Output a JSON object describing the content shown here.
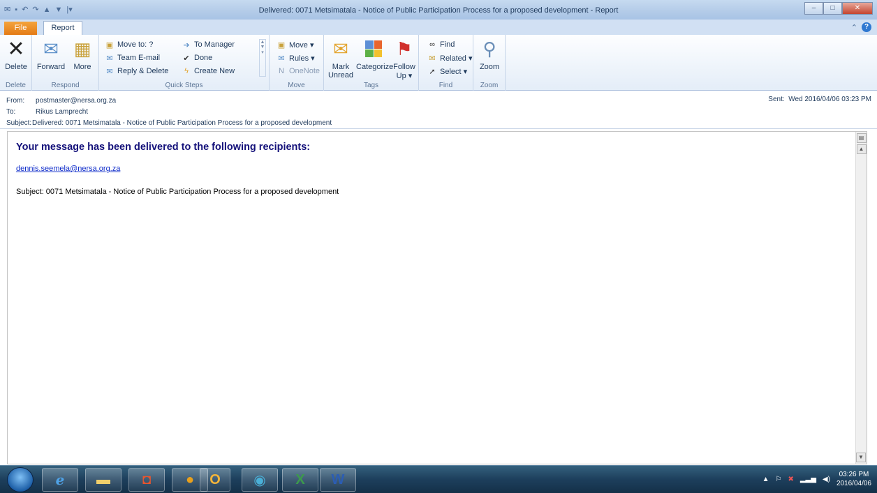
{
  "window": {
    "title": "Delivered: 0071 Metsimatala - Notice of Public Participation Process for a proposed development  -  Report",
    "buttons": {
      "minimize": "–",
      "maximize": "□",
      "close": "✕"
    }
  },
  "tabs": {
    "file": "File",
    "report": "Report"
  },
  "ribbon": {
    "delete_group": {
      "delete_label": "Delete",
      "group_label": "Delete"
    },
    "respond_group": {
      "forward_label": "Forward",
      "more_label": "More",
      "group_label": "Respond"
    },
    "quicksteps_group": {
      "items": [
        "Move to: ?",
        "Team E-mail",
        "Reply & Delete",
        "To Manager",
        "Done",
        "Create New"
      ],
      "group_label": "Quick Steps"
    },
    "move_group": {
      "move_label": "Move ▾",
      "rules_label": "Rules ▾",
      "onenote_label": "OneNote",
      "group_label": "Move"
    },
    "tags_group": {
      "mark_unread_label": "Mark Unread",
      "categorize_label": "Categorize",
      "followup_label": "Follow Up ▾",
      "group_label": "Tags"
    },
    "find_group": {
      "find_label": "Find",
      "related_label": "Related ▾",
      "select_label": "Select ▾",
      "group_label": "Find"
    },
    "zoom_group": {
      "zoom_label": "Zoom",
      "group_label": "Zoom"
    }
  },
  "header": {
    "from_label": "From:",
    "from_value": "postmaster@nersa.org.za",
    "to_label": "To:",
    "to_value": "Rikus Lamprecht",
    "subject_label": "Subject:",
    "subject_value": "Delivered: 0071 Metsimatala - Notice of Public Participation Process for a proposed development",
    "sent_label": "Sent:",
    "sent_value": "Wed 2016/04/06 03:23 PM"
  },
  "message": {
    "heading": "Your message has been delivered to the following recipients:",
    "recipient": "dennis.seemela@nersa.org.za",
    "subject_line": "Subject: 0071 Metsimatala - Notice of Public Participation Process for a proposed development"
  },
  "taskbar": {
    "icons": [
      "start-button",
      "internet-explorer-icon",
      "file-explorer-icon",
      "media-player-icon",
      "chrome-icon",
      "outlook-icon",
      "quicklook-icon",
      "excel-icon",
      "word-icon"
    ],
    "time": "03:26 PM",
    "date": "2016/04/06"
  },
  "colors": {
    "accent": "#1e395b",
    "file_tab": "#e47b16",
    "heading": "#14117a",
    "link": "#0b29c9"
  }
}
